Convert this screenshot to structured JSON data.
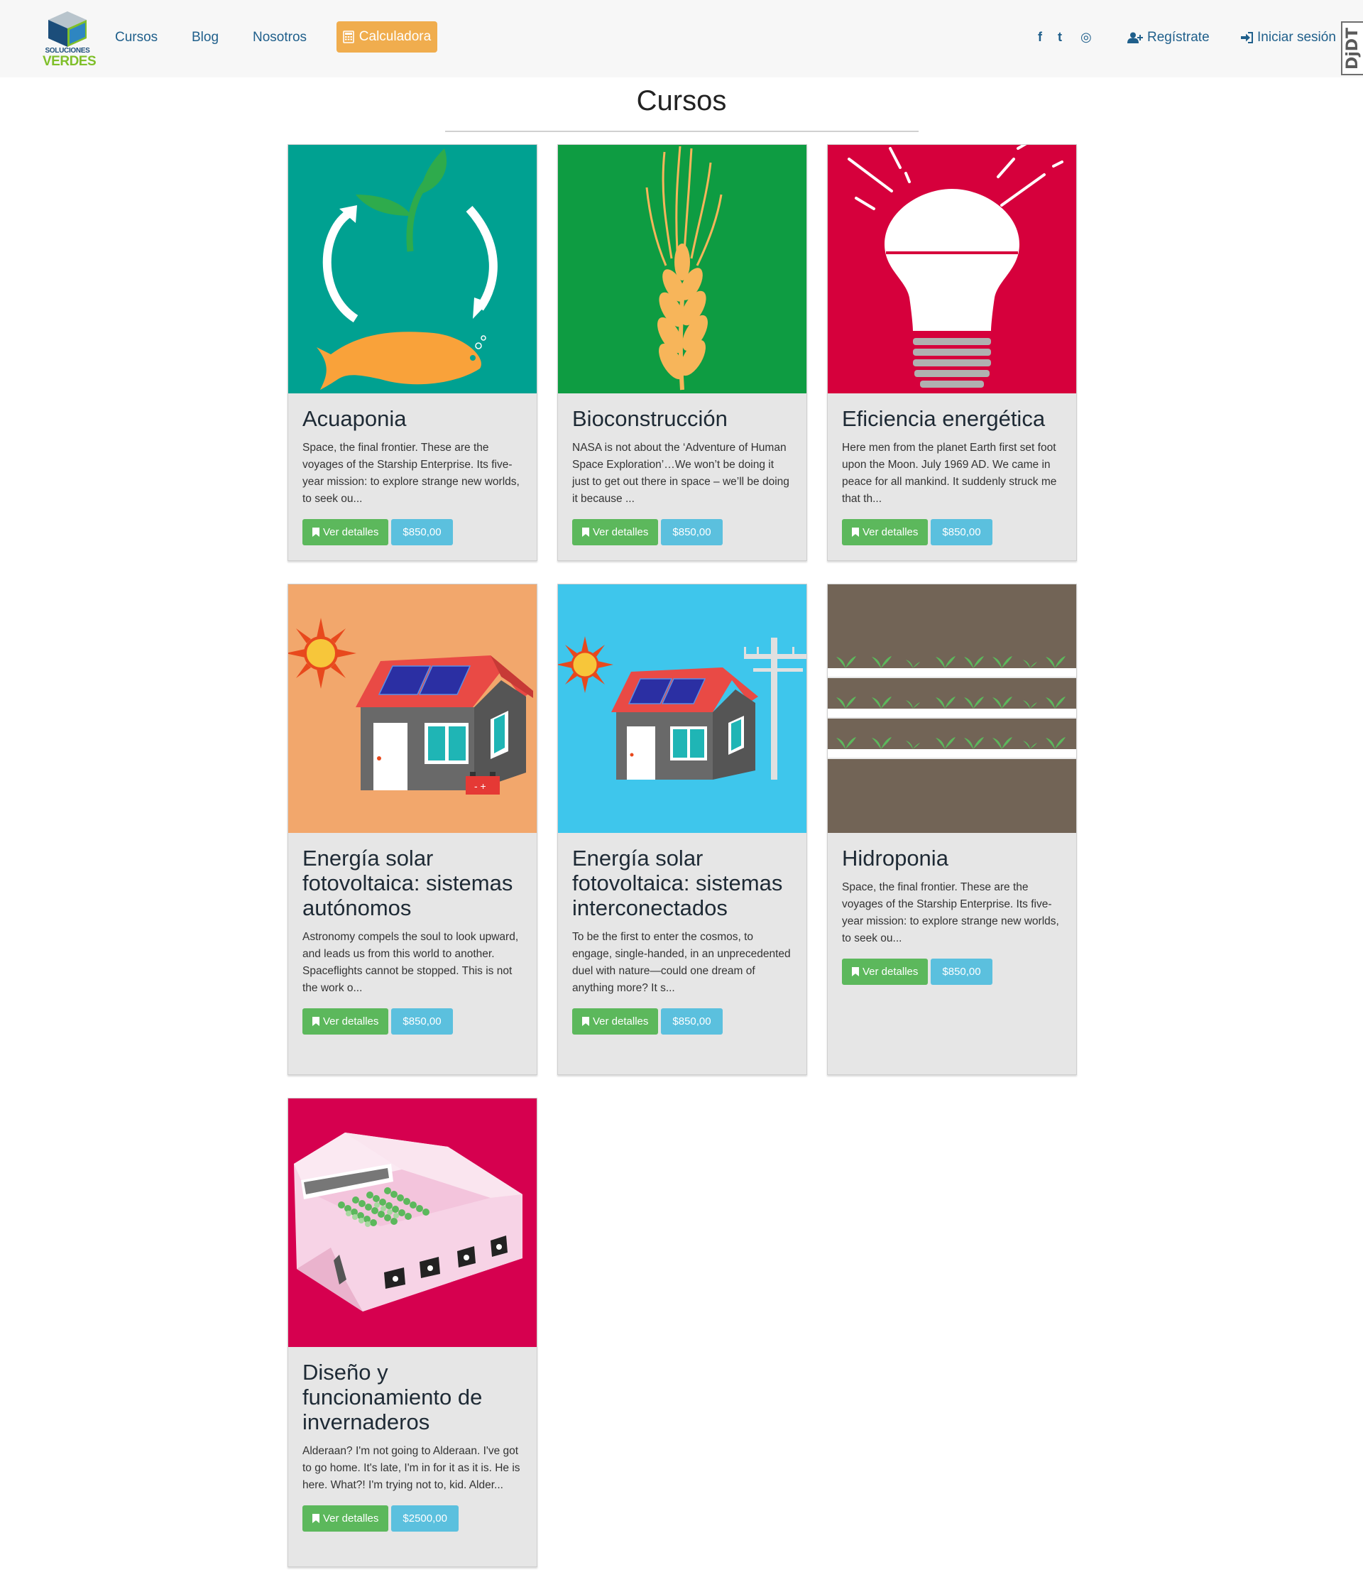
{
  "brand": {
    "line1": "SOLUCIONES",
    "line2": "VERDES"
  },
  "nav": {
    "cursos": "Cursos",
    "blog": "Blog",
    "nosotros": "Nosotros",
    "calculadora": "Calculadora",
    "registrate": "Regístrate",
    "iniciar": "Iniciar sesión",
    "ddt": "DjDT"
  },
  "social": {
    "facebook": "f",
    "twitter": "t",
    "instagram": "◎"
  },
  "page_title": "Cursos",
  "cards": [
    {
      "title": "Acuaponia",
      "desc": "Space, the final frontier. These are the voyages of the Starship Enterprise. Its five-year mission: to explore strange new worlds, to seek ou...",
      "details": "Ver detalles",
      "price": "$850,00",
      "image": "aquaponics-illustration"
    },
    {
      "title": "Bioconstrucción",
      "desc": "NASA is not about the ‘Adventure of Human Space Exploration’…We won’t be doing it just to get out there in space – we’ll be doing it because ...",
      "details": "Ver detalles",
      "price": "$850,00",
      "image": "wheat-illustration"
    },
    {
      "title": "Eficiencia energética",
      "desc": "Here men from the planet Earth first set foot upon the Moon. July 1969 AD. We came in peace for all mankind. It suddenly struck me that th...",
      "details": "Ver detalles",
      "price": "$850,00",
      "image": "lightbulb-illustration"
    },
    {
      "title": "Energía solar fotovoltaica: sistemas autónomos",
      "desc": "Astronomy compels the soul to look upward, and leads us from this world to another. Spaceflights cannot be stopped. This is not the work o...",
      "details": "Ver detalles",
      "price": "$850,00",
      "image": "solar-house-battery-illustration"
    },
    {
      "title": "Energía solar fotovoltaica: sistemas interconectados",
      "desc": "To be the first to enter the cosmos, to engage, single-handed, in an unprecedented duel with nature—could one dream of anything more? It s...",
      "details": "Ver detalles",
      "price": "$850,00",
      "image": "solar-house-grid-illustration"
    },
    {
      "title": "Hidroponia",
      "desc": "Space, the final frontier. These are the voyages of the Starship Enterprise. Its five-year mission: to explore strange new worlds, to seek ou...",
      "details": "Ver detalles",
      "price": "$850,00",
      "image": "hydroponics-illustration"
    },
    {
      "title": "Diseño y funcionamiento de invernaderos",
      "desc": "Alderaan? I'm not going to Alderaan. I've got to go home. It's late, I'm in for it as it is. He is here. What?! I'm trying not to, kid. Alder...",
      "details": "Ver detalles",
      "price": "$2500,00",
      "image": "greenhouse-illustration"
    }
  ],
  "colors": {
    "nav_link": "#1f5f8b",
    "calc": "#f0ad4e",
    "details_btn": "#5cb85c",
    "price_btn": "#5bc0de",
    "card_bg": "#e6e6e6"
  }
}
